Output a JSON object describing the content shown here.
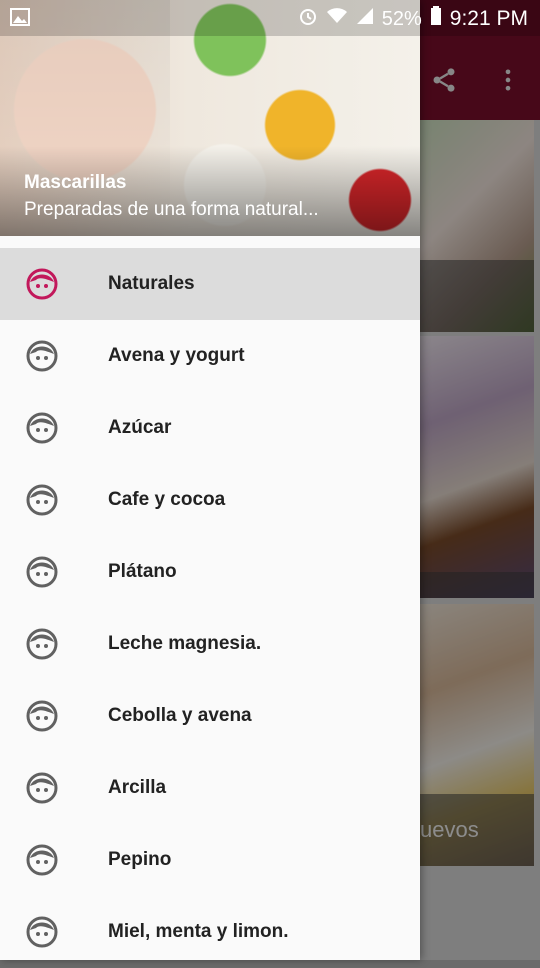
{
  "status_bar": {
    "battery": "52%",
    "time": "9:21 PM"
  },
  "app": {
    "cards": [
      {
        "caption": ""
      },
      {
        "caption": ""
      },
      {
        "caption": "uevos"
      }
    ]
  },
  "drawer": {
    "header": {
      "title": "Mascarillas",
      "subtitle": "Preparadas de una forma natural..."
    },
    "items": [
      {
        "label": "Naturales",
        "icon": "face-icon",
        "active": true
      },
      {
        "label": "Avena y yogurt",
        "icon": "face-icon"
      },
      {
        "label": "Azúcar",
        "icon": "face-icon"
      },
      {
        "label": "Cafe y cocoa",
        "icon": "face-icon"
      },
      {
        "label": "Plátano",
        "icon": "face-icon"
      },
      {
        "label": "Leche magnesia.",
        "icon": "face-icon"
      },
      {
        "label": "Cebolla y avena",
        "icon": "face-icon"
      },
      {
        "label": "Arcilla",
        "icon": "face-icon"
      },
      {
        "label": "Pepino",
        "icon": "face-icon"
      },
      {
        "label": "Miel, menta y limon.",
        "icon": "face-icon"
      }
    ]
  },
  "colors": {
    "toolbar": "#7a0f2b",
    "active_icon": "#c2185b",
    "inactive_icon": "#616161"
  }
}
